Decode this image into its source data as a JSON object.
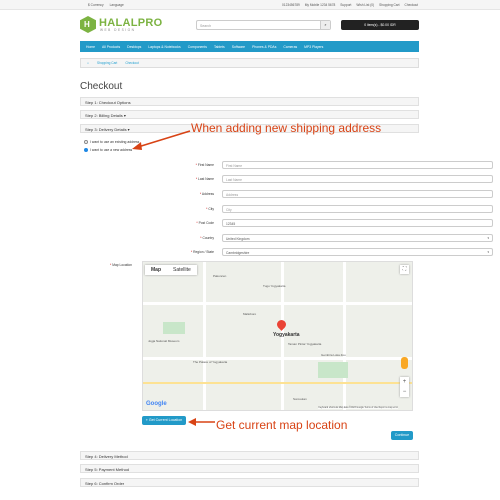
{
  "topbar": {
    "currency": "$ Currency",
    "language": "Language",
    "phone": "0123456789",
    "whatsapp": "My Mobile 1234 5678",
    "support": "Support",
    "wishlist": "Wish List (0)",
    "cart": "Shopping Cart",
    "checkout": "Checkout"
  },
  "logo": {
    "mark": "H",
    "name": "HALALPRO",
    "tagline": "WEB DESIGN"
  },
  "search": {
    "placeholder": "Search"
  },
  "cart_button": "0 item(s) - $0.00 IDR",
  "nav": [
    "Home",
    "All Products",
    "Desktops",
    "Laptops & Notebooks",
    "Components",
    "Tablets",
    "Software",
    "Phones & PDAs",
    "Cameras",
    "MP3 Players"
  ],
  "breadcrumbs": [
    "Shopping Cart",
    "Checkout"
  ],
  "page_title": "Checkout",
  "steps": {
    "s1": "Step 1: Checkout Options",
    "s2": "Step 2: Billing Details ▾",
    "s3": "Step 3: Delivery Details ▾",
    "s4": "Step 4: Delivery Method",
    "s5": "Step 5: Payment Method",
    "s6": "Step 6: Confirm Order"
  },
  "address_options": {
    "existing": "I want to use an existing address",
    "new": "I want to use a new address"
  },
  "form": {
    "first_name": {
      "label": "First Name",
      "placeholder": "First Name"
    },
    "last_name": {
      "label": "Last Name",
      "placeholder": "Last Name"
    },
    "address": {
      "label": "Address",
      "placeholder": "Address"
    },
    "city": {
      "label": "City",
      "placeholder": "City"
    },
    "post_code": {
      "label": "Post Code",
      "value": "12345"
    },
    "country": {
      "label": "Country",
      "value": "United Kingdom"
    },
    "region": {
      "label": "Region / State",
      "value": "Cambridgeshire"
    },
    "map_location": {
      "label": "Map Location"
    }
  },
  "map": {
    "tabs": [
      "Map",
      "Satellite"
    ],
    "city_label": "Yogyakarta",
    "places": [
      "Tugu Yogyakarta",
      "Malioboro",
      "Jogja National Museum",
      "Taman Pintar Yogyakarta",
      "The Palace of Yogyakarta",
      "Gembira Loka Zoo",
      "Pakuncen",
      "Sorosutan"
    ],
    "google": "Google",
    "attribution": "Keyboard shortcuts  Map data ©2023 Google  Terms of Use  Report a map error"
  },
  "buttons": {
    "current_location": "Get Current Location",
    "continue": "Continue"
  },
  "annotations": {
    "new_address": "When adding new shipping address",
    "map_location": "Get current map location"
  },
  "colors": {
    "primary": "#229ac8",
    "annotation": "#d84315",
    "logo": "#7cb342"
  }
}
